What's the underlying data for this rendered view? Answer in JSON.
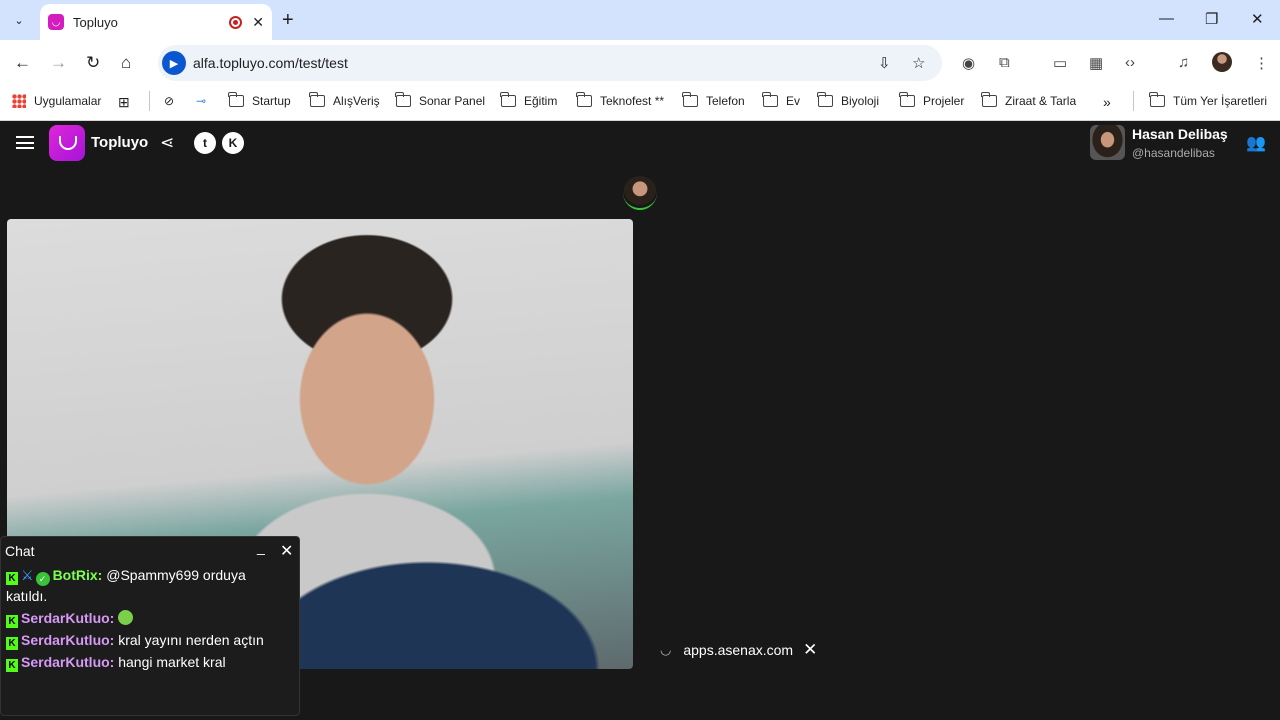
{
  "browser": {
    "tab_title": "Topluyo",
    "url": "alfa.topluyo.com/test/test",
    "bookmarks": [
      "Uygulamalar",
      "Startup",
      "AlışVeriş",
      "Sonar Panel",
      "Eğitim",
      "Teknofest **",
      "Telefon",
      "Ev",
      "Biyoloji",
      "Projeler",
      "Ziraat & Tarla",
      "Tüm Yer İşaretleri"
    ]
  },
  "app": {
    "brand": "Topluyo",
    "user": {
      "name": "Hasan Delibaş",
      "handle": "@hasandelibas"
    }
  },
  "chat": {
    "title": "Chat",
    "messages": [
      {
        "user": "BotRix:",
        "text": "@Spammy699 orduya",
        "text2": "katıldı."
      },
      {
        "user": "SerdarKutluo:",
        "text": ""
      },
      {
        "user": "SerdarKutluo:",
        "text": "kral yayını nerden açtın"
      },
      {
        "user": "SerdarKutluo:",
        "text": "hangi market kral"
      }
    ]
  },
  "screenshare": {
    "domain": "apps.asenax.com"
  },
  "icons": {
    "accent": "#d31dbf",
    "kick_green": "#53fc18",
    "speaking_ring": "#3ac23a"
  }
}
